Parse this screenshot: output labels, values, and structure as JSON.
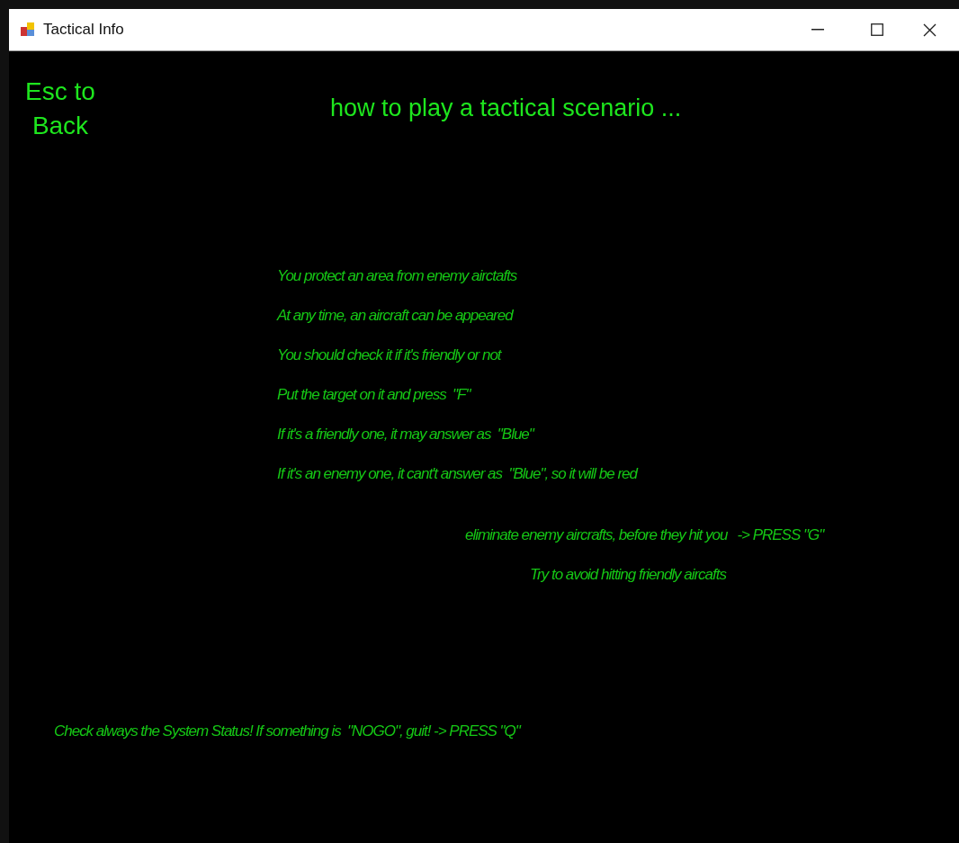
{
  "window": {
    "title": "Tactical Info"
  },
  "back_label": "Esc to Back",
  "heading": "how to play a tactical scenario ...",
  "instructions": [
    "You protect an area from enemy airctafts",
    "At any time, an aircraft can be appeared",
    "You should check it if it's friendly or not",
    "Put the target on it and press  \"F\"",
    "If it's a friendly one, it may answer as  \"Blue\"",
    "If it's an enemy one, it cant't answer as  \"Blue\", so it will be red"
  ],
  "actions": [
    "eliminate enemy aircrafts, before they hit you   -> PRESS \"G\"",
    "Try to avoid hitting friendly aircafts"
  ],
  "warning": "Check always the System Status! If something is  \"NOGO\", guit! -> PRESS \"Q\""
}
